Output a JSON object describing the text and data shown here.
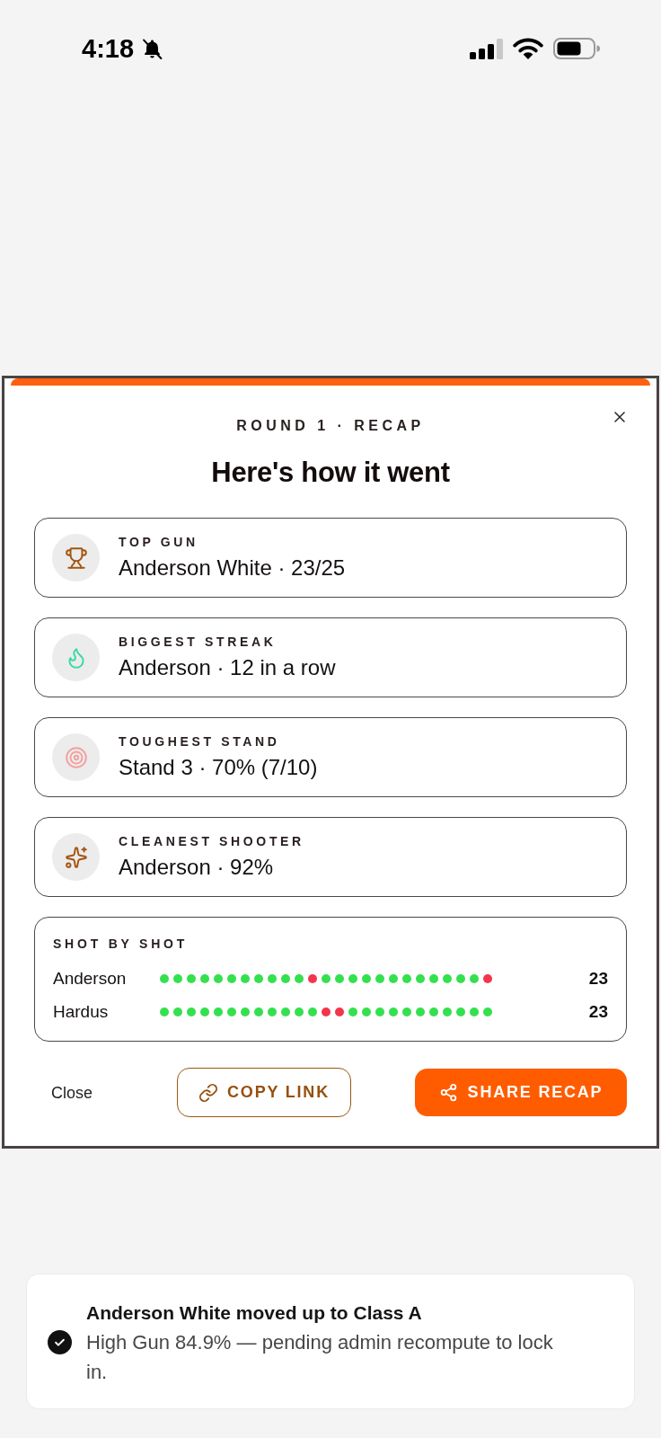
{
  "status_bar": {
    "time": "4:18"
  },
  "recap": {
    "eyebrow": "ROUND 1 · RECAP",
    "title": "Here's how it went",
    "stats": [
      {
        "label": "TOP GUN",
        "value": "Anderson White · 23/25"
      },
      {
        "label": "BIGGEST STREAK",
        "value": "Anderson · 12 in a row"
      },
      {
        "label": "TOUGHEST STAND",
        "value": "Stand 3 · 70% (7/10)"
      },
      {
        "label": "CLEANEST SHOOTER",
        "value": "Anderson · 92%"
      }
    ],
    "shot_by_shot": {
      "title": "SHOT BY SHOT",
      "rows": [
        {
          "name": "Anderson",
          "hits": [
            true,
            true,
            true,
            true,
            true,
            true,
            true,
            true,
            true,
            true,
            true,
            false,
            true,
            true,
            true,
            true,
            true,
            true,
            true,
            true,
            true,
            true,
            true,
            true,
            false
          ],
          "score": "23"
        },
        {
          "name": "Hardus",
          "hits": [
            true,
            true,
            true,
            true,
            true,
            true,
            true,
            true,
            true,
            true,
            true,
            true,
            false,
            false,
            true,
            true,
            true,
            true,
            true,
            true,
            true,
            true,
            true,
            true,
            true
          ],
          "score": "23"
        }
      ]
    },
    "actions": [
      {
        "label": "Close",
        "kind": "text"
      },
      {
        "label": "COPY LINK",
        "kind": "outline"
      },
      {
        "label": "SHARE RECAP",
        "kind": "primary"
      }
    ]
  },
  "toast": {
    "title": "Anderson White moved up to Class A",
    "message": "High Gun 84.9% — pending admin recompute to lock in."
  }
}
